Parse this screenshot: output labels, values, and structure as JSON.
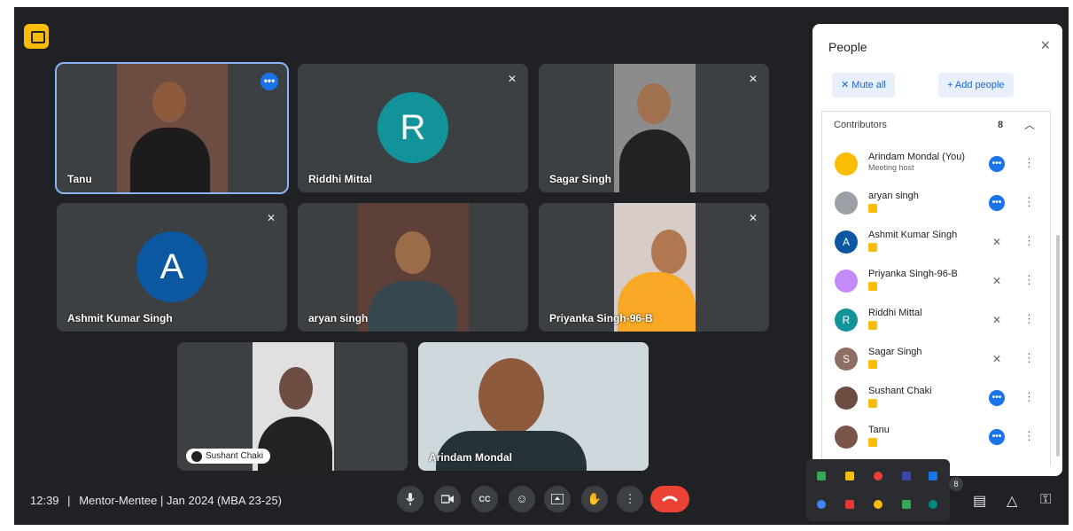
{
  "tiles": [
    {
      "name": "Tanu",
      "indicator": "more"
    },
    {
      "name": "Riddhi Mittal",
      "initial": "R",
      "avatar_color": "#12939a",
      "indicator": "mic-off"
    },
    {
      "name": "Sagar Singh",
      "indicator": "mic-off"
    },
    {
      "name": "Ashmit Kumar Singh",
      "initial": "A",
      "avatar_color": "#0b57a0",
      "indicator": "mic-off"
    },
    {
      "name": "aryan singh"
    },
    {
      "name": "Priyanka Singh-96-B",
      "indicator": "mic-off"
    },
    {
      "name": "Sushant Chaki",
      "style": "pill"
    },
    {
      "name": "Arindam Mondal"
    }
  ],
  "meeting": {
    "time": "12:39",
    "separator": "|",
    "title": "Mentor-Mentee | Jan 2024 (MBA 23-25)"
  },
  "controls": {
    "mic": "microphone-icon",
    "camera": "camera-icon",
    "captions_label": "CC",
    "emoji": "emoji-icon",
    "present": "present-icon",
    "hand": "hand-icon",
    "more": "more-icon",
    "end": "end-call-icon"
  },
  "panel": {
    "title": "People",
    "close": "×",
    "mute_all": "Mute all",
    "add_people": "Add people",
    "section_label": "Contributors",
    "count": "8"
  },
  "people": [
    {
      "name": "Arindam Mondal (You)",
      "sub": "Meeting host",
      "state": "on",
      "color": "#fbbc04"
    },
    {
      "name": "aryan singh",
      "state": "on",
      "color": "#9aa0a6"
    },
    {
      "name": "Ashmit Kumar Singh",
      "initial": "A",
      "state": "off",
      "color": "#0b57a0"
    },
    {
      "name": "Priyanka Singh-96-B",
      "state": "off",
      "color": "#c58af9"
    },
    {
      "name": "Riddhi Mittal",
      "initial": "R",
      "state": "off",
      "color": "#12939a"
    },
    {
      "name": "Sagar Singh",
      "initial": "S",
      "state": "off",
      "color": "#8d6e63"
    },
    {
      "name": "Sushant Chaki",
      "state": "on",
      "color": "#6d4c41"
    },
    {
      "name": "Tanu",
      "state": "on",
      "color": "#795548"
    }
  ],
  "tray_badge": "8"
}
